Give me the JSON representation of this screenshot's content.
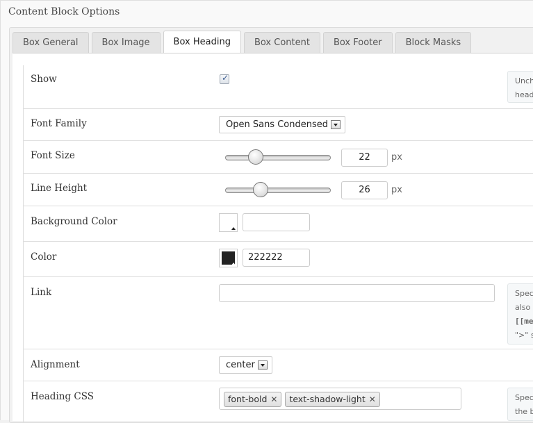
{
  "panel": {
    "title": "Content Block Options"
  },
  "tabs": [
    {
      "label": "Box General",
      "active": false
    },
    {
      "label": "Box Image",
      "active": false
    },
    {
      "label": "Box Heading",
      "active": true
    },
    {
      "label": "Box Content",
      "active": false
    },
    {
      "label": "Box Footer",
      "active": false
    },
    {
      "label": "Block Masks",
      "active": false
    }
  ],
  "fields": {
    "show": {
      "label": "Show",
      "checked": true,
      "hint_lines": [
        "Unch",
        "head"
      ]
    },
    "font_family": {
      "label": "Font Family",
      "value": "Open Sans Condensed"
    },
    "font_size": {
      "label": "Font Size",
      "value": "22",
      "unit": "px",
      "slider_fraction": 0.28
    },
    "line_height": {
      "label": "Line Height",
      "value": "26",
      "unit": "px",
      "slider_fraction": 0.33
    },
    "background_color": {
      "label": "Background Color",
      "value": "",
      "swatch_color": "#ffffff"
    },
    "color": {
      "label": "Color",
      "value": "222222",
      "swatch_color": "#222222"
    },
    "link": {
      "label": "Link",
      "value": "",
      "hint_lines": [
        "Spec",
        "also",
        "[[me",
        "\">\" s"
      ]
    },
    "alignment": {
      "label": "Alignment",
      "value": "center"
    },
    "heading_css": {
      "label": "Heading CSS",
      "tags": [
        "font-bold",
        "text-shadow-light"
      ],
      "hint_lines": [
        "Spec",
        "the b"
      ]
    }
  }
}
